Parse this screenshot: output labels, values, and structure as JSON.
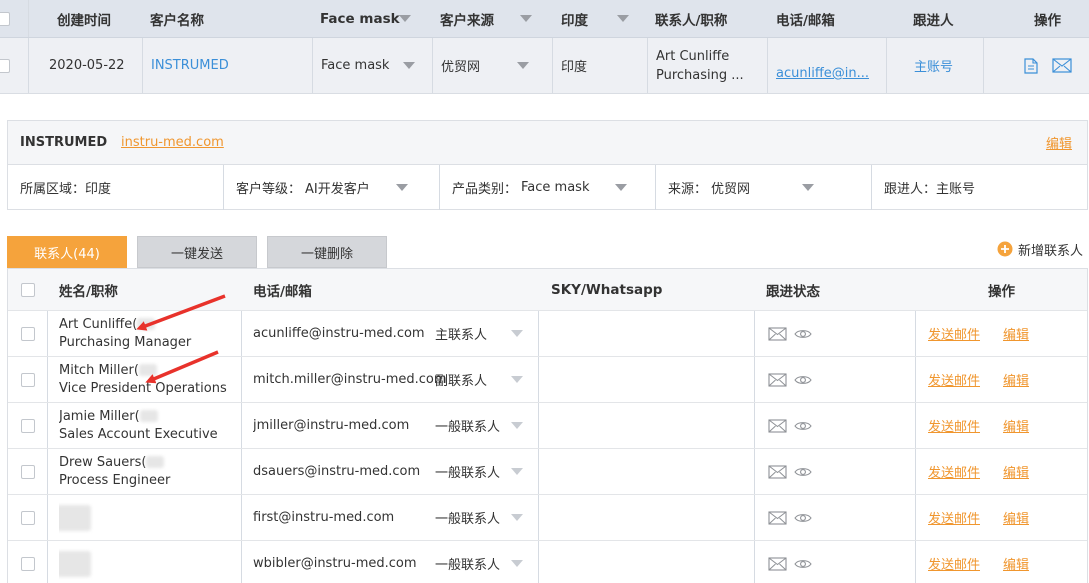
{
  "table_header": {
    "created": "创建时间",
    "customer": "客户名称",
    "product": "Face mask",
    "source": "客户来源",
    "region": "印度",
    "contact": "联系人/职称",
    "phone": "电话/邮箱",
    "follower": "跟进人",
    "actions": "操作"
  },
  "customer_row": {
    "date": "2020-05-22",
    "name": "INSTRUMED",
    "product": "Face mask",
    "source": "优贸网",
    "region": "印度",
    "contact_name": "Art Cunliffe",
    "contact_title": "Purchasing ...",
    "email": "acunliffe@in...",
    "follower": "主账号"
  },
  "customer_card": {
    "name": "INSTRUMED",
    "website": "instru-med.com",
    "edit": "编辑",
    "region": "所属区域：印度",
    "level_label": "客户等级：",
    "level_value": "AI开发客户",
    "category_label": "产品类别：",
    "category_value": "Face mask",
    "source_label": "来源：",
    "source_value": "优贸网",
    "follower": "跟进人：主账号"
  },
  "tabs": {
    "contacts": "联系人(44)",
    "send_all": "一键发送",
    "delete_all": "一键删除",
    "add_contact": "新增联系人"
  },
  "contacts_header": {
    "name_title": "姓名/职称",
    "phone_email": "电话/邮箱",
    "sky": "SKY/Whatsapp",
    "status": "跟进状态",
    "actions": "操作"
  },
  "contacts": [
    {
      "name": "Art Cunliffe(",
      "title": "Purchasing Manager",
      "email": "acunliffe@instru-med.com",
      "role": "主联系人",
      "send": "发送邮件",
      "edit": "编辑"
    },
    {
      "name": "Mitch Miller(",
      "title": "Vice President Operations",
      "email": "mitch.miller@instru-med.com",
      "role": "副联系人",
      "send": "发送邮件",
      "edit": "编辑"
    },
    {
      "name": "Jamie Miller(",
      "title": "Sales Account Executive",
      "email": "jmiller@instru-med.com",
      "role": "一般联系人",
      "send": "发送邮件",
      "edit": "编辑"
    },
    {
      "name": "Drew Sauers(",
      "title": "Process Engineer",
      "email": "dsauers@instru-med.com",
      "role": "一般联系人",
      "send": "发送邮件",
      "edit": "编辑"
    },
    {
      "name": "",
      "title": "",
      "email": "first@instru-med.com",
      "role": "一般联系人",
      "send": "发送邮件",
      "edit": "编辑"
    },
    {
      "name": "",
      "title": "",
      "email": "wbibler@instru-med.com",
      "role": "一般联系人",
      "send": "发送邮件",
      "edit": "编辑"
    }
  ],
  "colors": {
    "accent_orange": "#f5a33c",
    "link_blue": "#3b8fd8",
    "annotation_red": "#e8322b",
    "header_bg": "#dfe4ec"
  },
  "icons": [
    "checkbox",
    "caret-down-icon",
    "document-icon",
    "mail-icon",
    "eye-icon",
    "plus-circle-icon",
    "red-arrow-annotation"
  ]
}
